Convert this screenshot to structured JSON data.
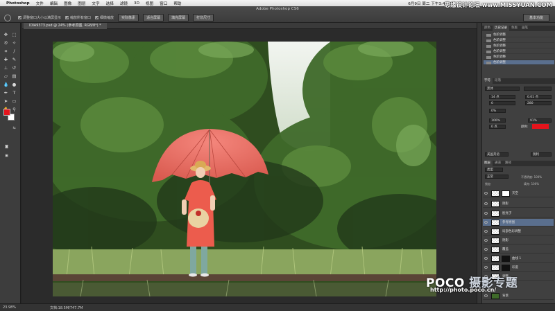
{
  "menubar": {
    "app": "Photoshop",
    "items": [
      "文件",
      "编辑",
      "图像",
      "图层",
      "文字",
      "选择",
      "滤镜",
      "3D",
      "视图",
      "窗口",
      "帮助"
    ],
    "clock": "6月9日 周二 下午3:44:01",
    "workspace": "基本功能"
  },
  "options": {
    "window_title": "Adobe Photoshop CS6",
    "resize_windows": "调整窗口大小以满屏显示",
    "zoom_all": "缩放所有窗口",
    "scrubby_zoom": "细微缩放",
    "btn_actual": "实际像素",
    "btn_fit": "适合屏幕",
    "btn_fill": "填充屏幕",
    "btn_print": "打印尺寸"
  },
  "document": {
    "tab": "IDIA9373.psd @ 24% (参考原图, RGB/8*) *",
    "zoom": "23.98%",
    "doc_size": "文档:18.5M/747.7M"
  },
  "history": {
    "tabs": [
      "颜色",
      "历史记录",
      "色板",
      "画笔"
    ],
    "items": [
      "色阶调整",
      "色阶调整",
      "色阶调整",
      "色阶调整",
      "色阶调整",
      "色阶调整"
    ]
  },
  "character": {
    "tabs": [
      "字符",
      "段落"
    ],
    "font": "黑体",
    "size": "14 点",
    "leading": "0.01 点",
    "tracking": "0",
    "kerning": "280",
    "scale_v": "0%",
    "scale_h": "100%",
    "scale_right": "91%",
    "baseline": "0 点",
    "color_label": "颜色:",
    "color": "#e4141c",
    "lang": "美国英语",
    "aa": "锐利"
  },
  "layers": {
    "tabs": [
      "图层",
      "通道",
      "路径"
    ],
    "filter": "类型",
    "blend": "正常",
    "opacity": "不透明度: 100%",
    "fill": "填充: 100%",
    "lock": "锁定:",
    "items": [
      {
        "name": "天空",
        "selected": false
      },
      {
        "name": "阴影",
        "selected": false
      },
      {
        "name": "脸亮子",
        "selected": false
      },
      {
        "name": "参考原图",
        "selected": true
      },
      {
        "name": "局部色彩调整",
        "selected": false
      },
      {
        "name": "阴影",
        "selected": false
      },
      {
        "name": "覆盖",
        "selected": false
      },
      {
        "name": "曲线 1",
        "selected": false
      },
      {
        "name": "彩度",
        "selected": false
      },
      {
        "name": "调整",
        "selected": false
      },
      {
        "name": "背景",
        "selected": false
      }
    ]
  },
  "watermarks": {
    "top": "思缘设计论坛  www.MISSYUAN.COM",
    "logo_a": "POCO",
    "logo_b": " 摄影专题",
    "url": "http://photo.poco.cn/"
  }
}
